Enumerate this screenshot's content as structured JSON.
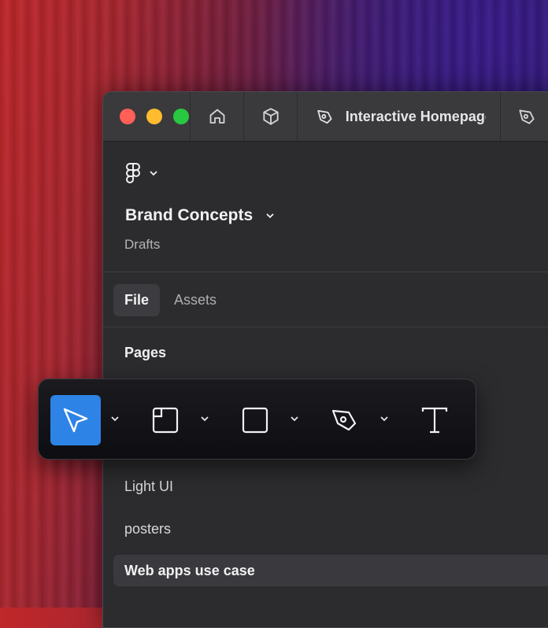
{
  "window": {
    "tabs": [
      {
        "label": "Interactive Homepage"
      }
    ]
  },
  "panel": {
    "project_name": "Brand Concepts",
    "location": "Drafts",
    "tabs": [
      {
        "label": "File",
        "active": true
      },
      {
        "label": "Assets",
        "active": false
      }
    ],
    "pages_heading": "Pages",
    "pages": [
      {
        "label": "Light UI",
        "selected": false
      },
      {
        "label": "posters",
        "selected": false
      },
      {
        "label": "Web apps use case",
        "selected": true
      }
    ]
  },
  "toolbar": {
    "tools": [
      {
        "icon": "move-pointer-icon",
        "active": true,
        "has_menu": true
      },
      {
        "icon": "frame-icon",
        "active": false,
        "has_menu": true
      },
      {
        "icon": "rectangle-icon",
        "active": false,
        "has_menu": true
      },
      {
        "icon": "pen-icon",
        "active": false,
        "has_menu": true
      },
      {
        "icon": "text-icon",
        "active": false,
        "has_menu": false
      }
    ]
  },
  "colors": {
    "accent": "#2d83e6",
    "traffic_red": "#fe5f57",
    "traffic_yellow": "#febc2e",
    "traffic_green": "#28c840"
  }
}
